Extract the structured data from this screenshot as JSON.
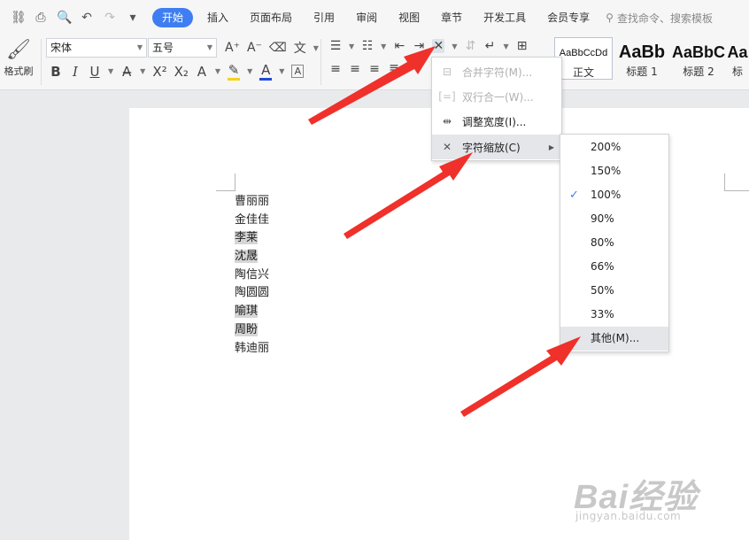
{
  "menubar": {
    "tabs": [
      "开始",
      "插入",
      "页面布局",
      "引用",
      "审阅",
      "视图",
      "章节",
      "开发工具",
      "会员专享"
    ],
    "active_tab": "开始",
    "search_placeholder": "查找命令、搜索模板"
  },
  "ribbon": {
    "format_painter_label": "格式刷",
    "font_name": "宋体",
    "font_size": "五号",
    "styles": [
      {
        "preview": "AaBbCcDd",
        "name": "正文"
      },
      {
        "preview": "AaBb",
        "name": "标题 1"
      },
      {
        "preview": "AaBbC",
        "name": "标题 2"
      },
      {
        "preview": "Aa",
        "name": "标"
      }
    ]
  },
  "document": {
    "names": [
      "曹丽丽",
      "金佳佳",
      "李莱",
      "沈晟",
      "陶信兴",
      "陶圆圆",
      "喻琪",
      "周盼",
      "韩迪丽"
    ],
    "highlighted_rows": [
      2,
      3,
      6,
      7
    ]
  },
  "menu": {
    "items": [
      {
        "label": "合并字符(M)...",
        "state": "disabled"
      },
      {
        "label": "双行合一(W)...",
        "state": "disabled"
      },
      {
        "label": "调整宽度(I)...",
        "state": "normal"
      },
      {
        "label": "字符缩放(C)",
        "state": "active"
      }
    ]
  },
  "submenu": {
    "items": [
      "200%",
      "150%",
      "100%",
      "90%",
      "80%",
      "66%",
      "50%",
      "33%",
      "其他(M)..."
    ],
    "checked": "100%",
    "hovered": "其他(M)..."
  },
  "watermark": {
    "logo": "Bai经验",
    "url": "jingyan.baidu.com"
  },
  "colors": {
    "accent": "#3f7ef2",
    "arrow": "#f0302a",
    "highlight_color": "#f5d31a",
    "font_color": "#1d4bd6"
  }
}
